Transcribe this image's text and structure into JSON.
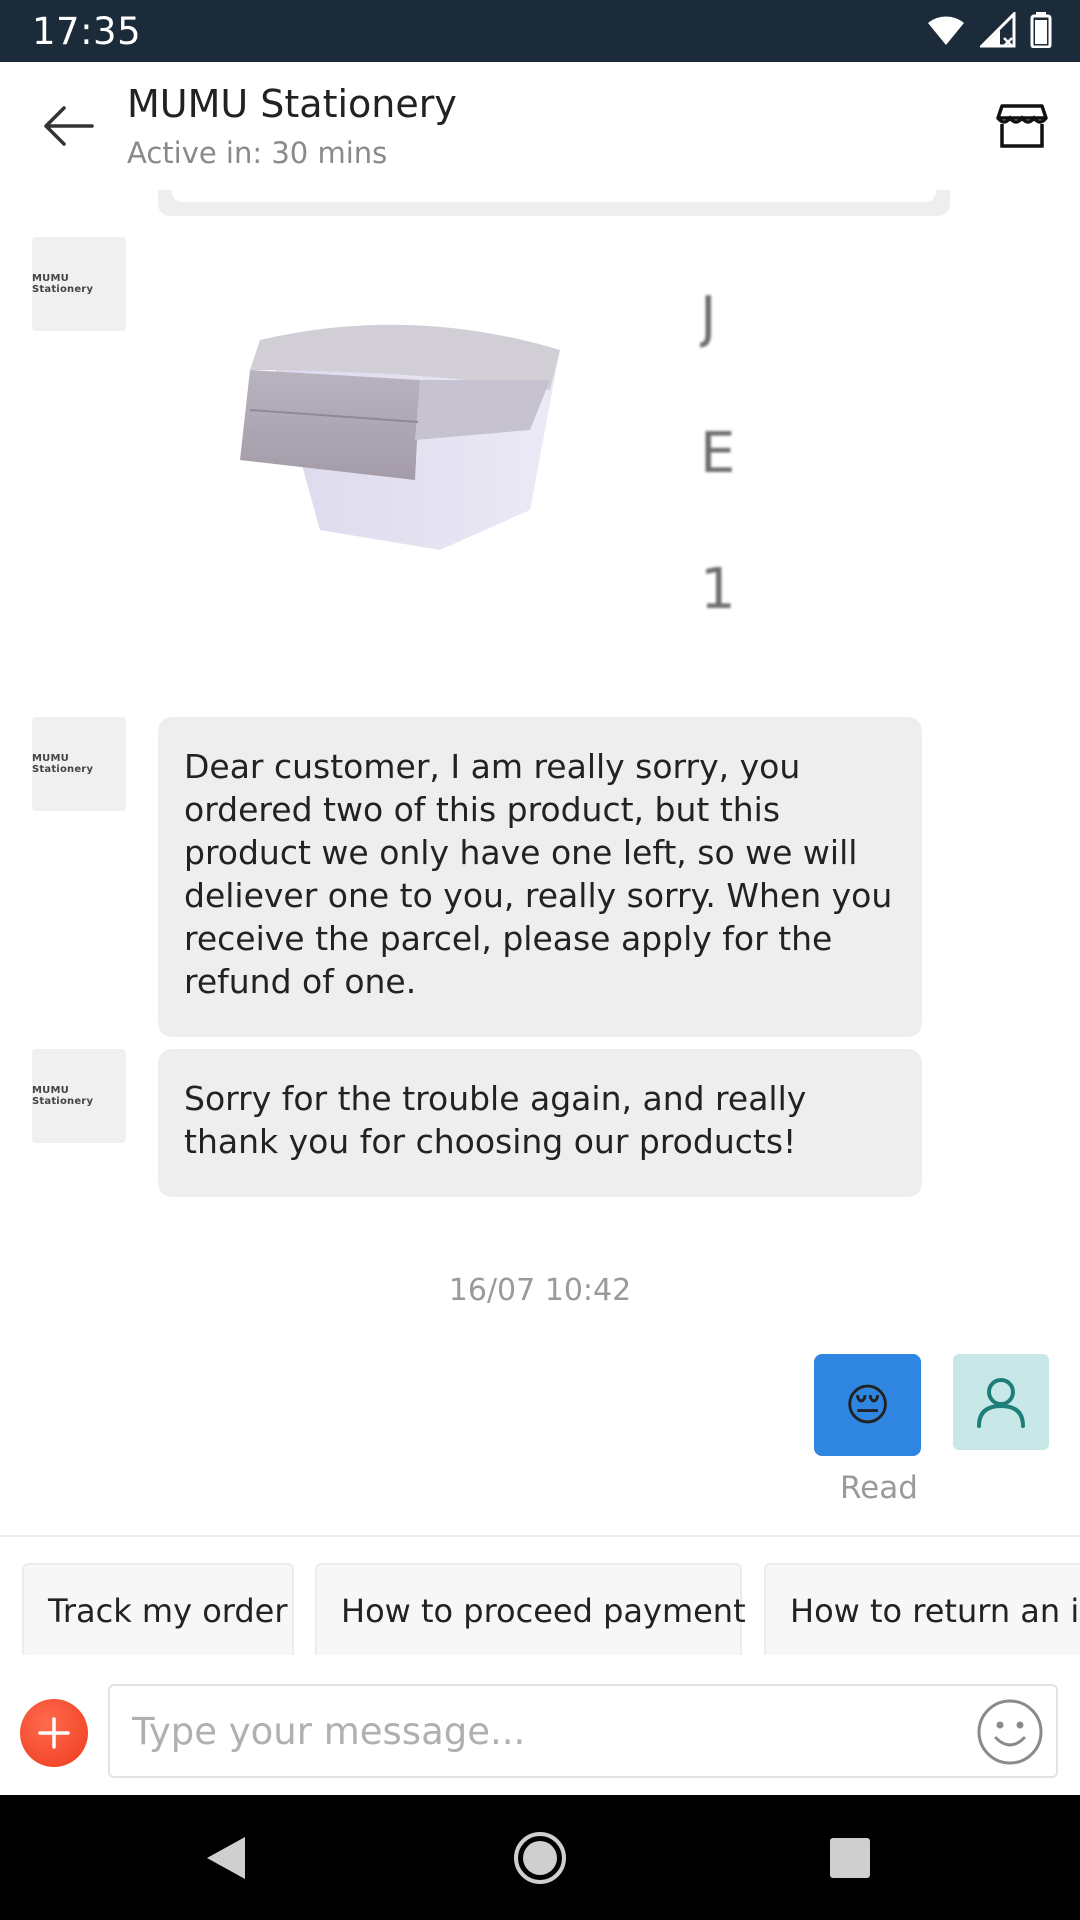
{
  "status_bar": {
    "time": "17:35",
    "icons": [
      "wifi-icon",
      "signal-icon",
      "battery-icon"
    ]
  },
  "header": {
    "title": "MUMU Stationery",
    "subtitle": "Active in: 30 mins",
    "back_icon": "back-arrow-icon",
    "shop_icon": "shop-icon"
  },
  "chat": {
    "shop_avatar_label": "MUMU Stationery",
    "product_text_fragment": [
      "J",
      "E",
      "1"
    ],
    "messages": [
      {
        "from": "shop",
        "text": "Dear customer, I am really sorry, you ordered two of this product, but this product we only have one left,  so we will deliever one to you, really sorry. When you receive the parcel, please apply for the refund of one."
      },
      {
        "from": "shop",
        "text": "Sorry for the trouble again, and really thank you for choosing our products!"
      }
    ],
    "timestamp": "16/07 10:42",
    "sent_emoji": "😔",
    "read_label": "Read"
  },
  "quick_replies": [
    "Track my order",
    "How to proceed payment",
    "How to return an ite"
  ],
  "input": {
    "placeholder": "Type your message..."
  },
  "colors": {
    "status_bar": "#1c2b3a",
    "bubble": "#eeeeee",
    "sent_bubble": "#2f86e0",
    "plus_button": "#ee3b1f",
    "my_avatar_bg": "#c7e8e6"
  }
}
